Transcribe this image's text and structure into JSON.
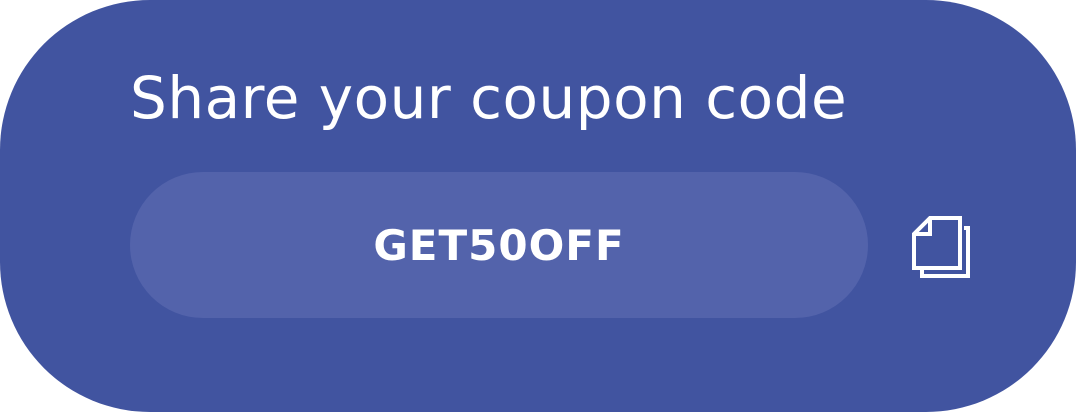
{
  "card": {
    "title": "Share your coupon code",
    "coupon_code": "GET50OFF",
    "copy_icon": "copy-icon"
  },
  "colors": {
    "card_background": "#4154a0",
    "code_pill_background": "#5363ab",
    "text": "#ffffff"
  }
}
